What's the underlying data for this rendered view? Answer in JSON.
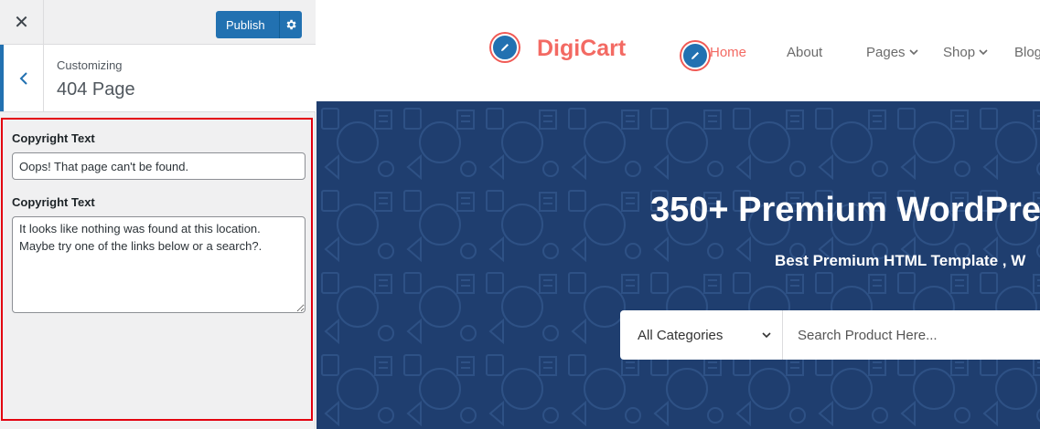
{
  "customizer": {
    "close_icon": "close-icon",
    "publish_label": "Publish",
    "settings_icon": "gear-icon",
    "section": {
      "breadcrumb": "Customizing",
      "title": "404 Page"
    },
    "fields": [
      {
        "label": "Copyright Text",
        "type": "text",
        "value": "Oops! That page can't be found."
      },
      {
        "label": "Copyright Text",
        "type": "textarea",
        "value": "It looks like nothing was found at this location. Maybe try one of the links below or a search?."
      }
    ]
  },
  "site": {
    "logo": "DigiCart",
    "nav": [
      {
        "label": "Home",
        "active": true
      },
      {
        "label": "About",
        "dropdown": false
      },
      {
        "label": "Pages",
        "dropdown": true
      },
      {
        "label": "Shop",
        "dropdown": true
      },
      {
        "label": "Blog",
        "dropdown": false
      }
    ],
    "hero": {
      "title": "350+ Premium WordPre",
      "subtitle": "Best Premium HTML Template , W",
      "search": {
        "category": "All Categories",
        "placeholder": "Search Product Here..."
      }
    },
    "colors": {
      "accent": "#f36a63",
      "hero_bg": "#1f3e6f",
      "wp_blue": "#2271b1",
      "highlight_border": "#e3000f"
    }
  }
}
